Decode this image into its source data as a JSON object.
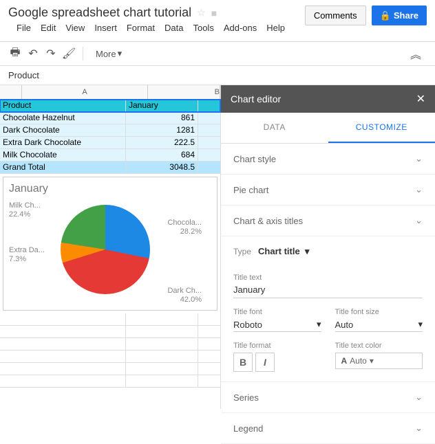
{
  "doc": {
    "title": "Google spreadsheet chart tutorial"
  },
  "buttons": {
    "comments": "Comments",
    "share": "Share"
  },
  "menu": {
    "file": "File",
    "edit": "Edit",
    "view": "View",
    "insert": "Insert",
    "format": "Format",
    "data": "Data",
    "tools": "Tools",
    "addons": "Add-ons",
    "help": "Help"
  },
  "toolbar": {
    "more": "More"
  },
  "namebox": "Product",
  "cols": {
    "a": "A",
    "b": "B"
  },
  "table": {
    "header": {
      "a": "Product",
      "b": "January"
    },
    "rows": [
      {
        "a": "Chocolate Hazelnut",
        "b": "861"
      },
      {
        "a": "Dark Chocolate",
        "b": "1281"
      },
      {
        "a": "Extra Dark Chocolate",
        "b": "222.5"
      },
      {
        "a": "Milk Chocolate",
        "b": "684"
      }
    ],
    "total": {
      "a": "Grand Total",
      "b": "3048.5"
    }
  },
  "chart_data": {
    "type": "pie",
    "title": "January",
    "categories": [
      "Chocolate Hazelnut",
      "Dark Chocolate",
      "Extra Dark Chocolate",
      "Milk Chocolate"
    ],
    "values": [
      861,
      1281,
      222.5,
      684
    ],
    "percentages": [
      28.2,
      42.0,
      7.3,
      22.4
    ],
    "colors": [
      "#1e88e5",
      "#e53935",
      "#fb8c00",
      "#43a047"
    ]
  },
  "pie_labels": {
    "l1": {
      "name": "Chocola...",
      "pct": "28.2%"
    },
    "l2": {
      "name": "Dark Ch...",
      "pct": "42.0%"
    },
    "l3": {
      "name": "Extra Da...",
      "pct": "7.3%"
    },
    "l4": {
      "name": "Milk Ch...",
      "pct": "22.4%"
    }
  },
  "editor": {
    "title": "Chart editor",
    "tabs": {
      "data": "DATA",
      "customize": "CUSTOMIZE"
    },
    "sections": {
      "chart_style": "Chart style",
      "pie_chart": "Pie chart",
      "chart_axis": "Chart & axis titles",
      "series": "Series",
      "legend": "Legend"
    },
    "type_label": "Type",
    "type_value": "Chart title",
    "title_text_label": "Title text",
    "title_text_value": "January",
    "title_font_label": "Title font",
    "title_font_value": "Roboto",
    "title_font_size_label": "Title font size",
    "title_font_size_value": "Auto",
    "title_format_label": "Title format",
    "title_color_label": "Title text color",
    "title_color_value": "Auto"
  }
}
